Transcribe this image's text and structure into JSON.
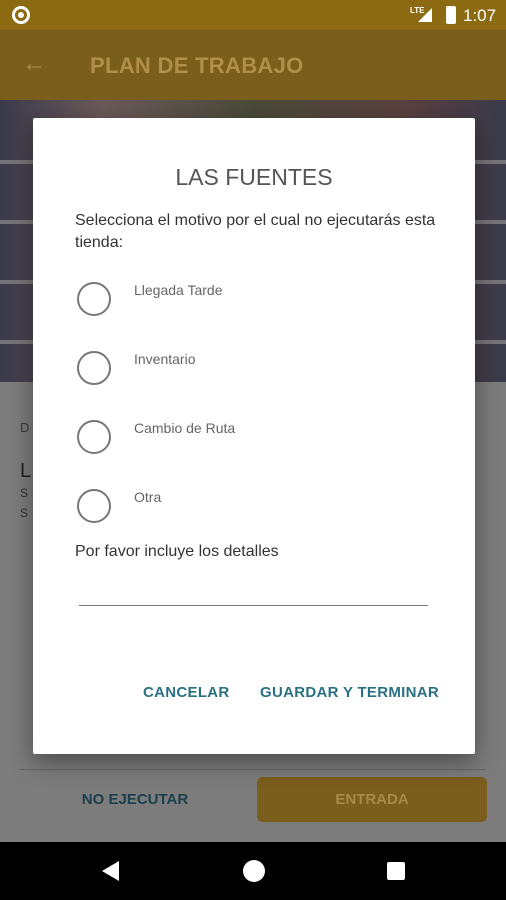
{
  "status_bar": {
    "lte": "LTE",
    "time": "1:07"
  },
  "app_bar": {
    "title": "PLAN DE TRABAJO"
  },
  "background_content": {
    "date_prefix": "D",
    "name_prefix": "L",
    "line1_prefix": "S",
    "line2_prefix": "S"
  },
  "bottom_actions": {
    "no_ejecutar": "NO EJECUTAR",
    "entrada": "ENTRADA"
  },
  "dialog": {
    "title": "LAS FUENTES",
    "prompt": "Selecciona el motivo por el cual no ejecutarás esta tienda:",
    "options": [
      {
        "label": "Llegada Tarde",
        "selected": false
      },
      {
        "label": "Inventario",
        "selected": false
      },
      {
        "label": "Cambio de Ruta",
        "selected": false
      },
      {
        "label": "Otra",
        "selected": false
      }
    ],
    "details_label": "Por favor incluye los detalles",
    "details_value": "",
    "cancel_label": "CANCELAR",
    "save_label": "GUARDAR Y TERMINAR"
  },
  "colors": {
    "brand_gold": "#c9952a",
    "accent_teal": "#2a7283"
  }
}
